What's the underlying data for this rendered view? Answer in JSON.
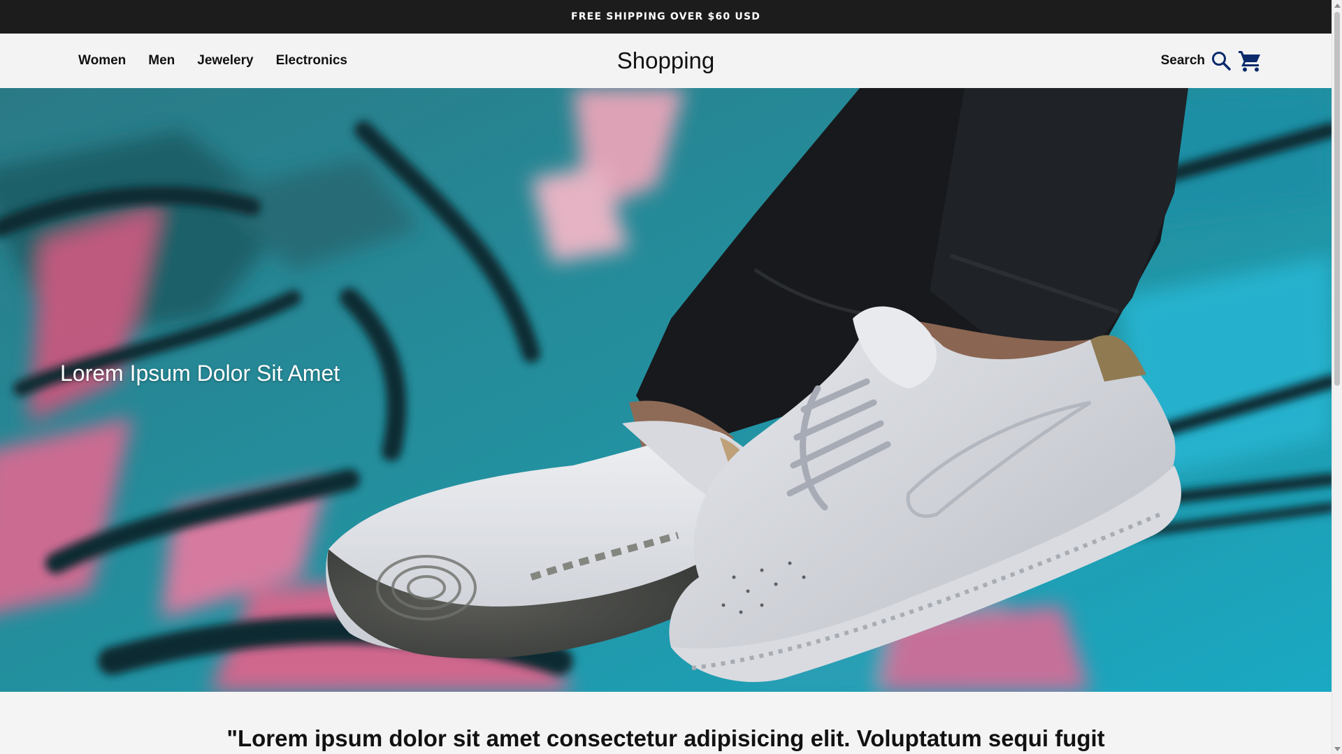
{
  "announcement": {
    "text": "FREE SHIPPING OVER $60 USD"
  },
  "nav": {
    "links": [
      "Women",
      "Men",
      "Jewelery",
      "Electronics"
    ],
    "brand": "Shopping",
    "search_label": "Search",
    "icons": {
      "search": "search-icon",
      "cart": "cart-icon"
    },
    "accent_color": "#0b2a6b"
  },
  "hero": {
    "heading": "Lorem Ipsum Dolor Sit Amet",
    "image_subject": "white sneakers on graffiti wall"
  },
  "quote": {
    "text": "\"Lorem ipsum dolor sit amet consectetur adipisicing elit. Voluptatum sequi fugit"
  },
  "colors": {
    "announcement_bg": "#1c1c1c",
    "navbar_bg": "#f3f3f3",
    "page_bg": "#f4f4f4",
    "text": "#111111"
  }
}
